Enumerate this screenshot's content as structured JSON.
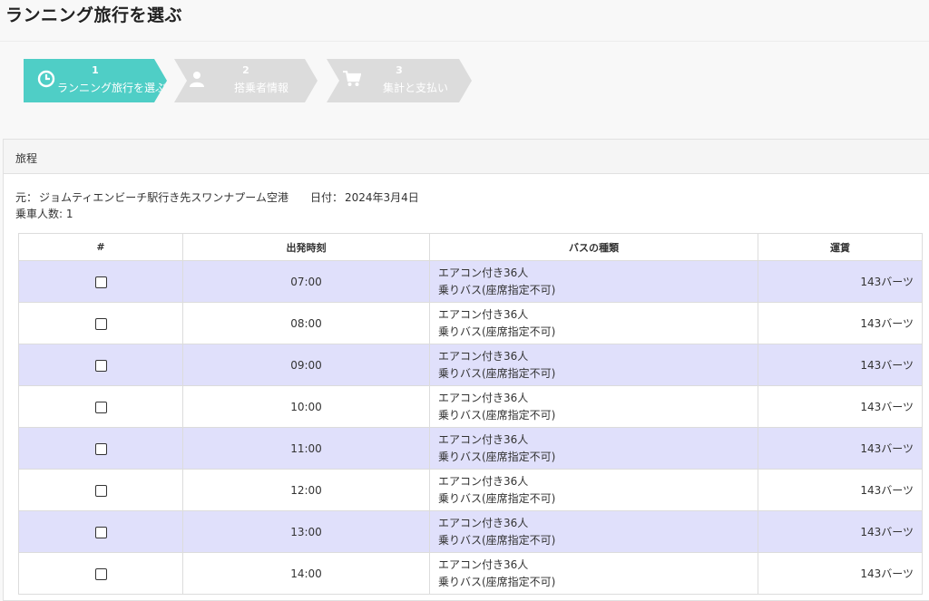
{
  "page": {
    "title": "ランニング旅行を選ぶ"
  },
  "steps": [
    {
      "number": "1",
      "label": "ランニング旅行を選ぶ",
      "icon": "clock-icon",
      "active": true
    },
    {
      "number": "2",
      "label": "搭乗者情報",
      "icon": "user-icon",
      "active": false
    },
    {
      "number": "3",
      "label": "集計と支払い",
      "icon": "cart-icon",
      "active": false
    }
  ],
  "colors": {
    "accent": "#4fcec6",
    "inactive_step": "#dcdcdc",
    "row_shade": "#e0e0fb"
  },
  "panel": {
    "heading": "旅程"
  },
  "trip": {
    "from_label": "元：",
    "from_value": "ジョムティエンビーチ駅行き先スワンナプーム空港",
    "date_label": "日付：",
    "date_value": "2024年3月4日",
    "passengers_label": "乗車人数:",
    "passengers_value": "1"
  },
  "table": {
    "headers": {
      "check": "#",
      "time": "出発時刻",
      "bus_type": "バスの種類",
      "fare": "運賃"
    },
    "rows": [
      {
        "time": "07:00",
        "type_line1": "エアコン付き36人",
        "type_line2": "乗りバス(座席指定不可)",
        "fare": "143バーツ"
      },
      {
        "time": "08:00",
        "type_line1": "エアコン付き36人",
        "type_line2": "乗りバス(座席指定不可)",
        "fare": "143バーツ"
      },
      {
        "time": "09:00",
        "type_line1": "エアコン付き36人",
        "type_line2": "乗りバス(座席指定不可)",
        "fare": "143バーツ"
      },
      {
        "time": "10:00",
        "type_line1": "エアコン付き36人",
        "type_line2": "乗りバス(座席指定不可)",
        "fare": "143バーツ"
      },
      {
        "time": "11:00",
        "type_line1": "エアコン付き36人",
        "type_line2": "乗りバス(座席指定不可)",
        "fare": "143バーツ"
      },
      {
        "time": "12:00",
        "type_line1": "エアコン付き36人",
        "type_line2": "乗りバス(座席指定不可)",
        "fare": "143バーツ"
      },
      {
        "time": "13:00",
        "type_line1": "エアコン付き36人",
        "type_line2": "乗りバス(座席指定不可)",
        "fare": "143バーツ"
      },
      {
        "time": "14:00",
        "type_line1": "エアコン付き36人",
        "type_line2": "乗りバス(座席指定不可)",
        "fare": "143バーツ"
      }
    ]
  }
}
